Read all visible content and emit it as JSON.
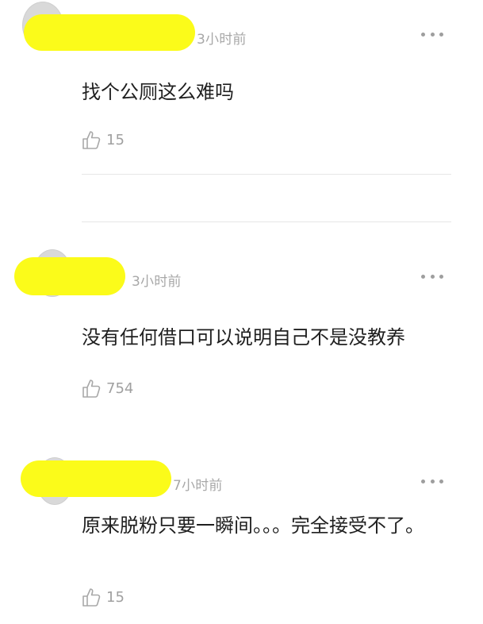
{
  "comments": [
    {
      "time": "3小时前",
      "text": "找个公厕这么难吗",
      "likes": "15",
      "more_icon": "more-dots-icon",
      "like_icon": "thumbs-up-icon"
    },
    {
      "time": "3小时前",
      "text": "没有任何借口可以说明自己不是没教养",
      "likes": "754",
      "more_icon": "more-dots-icon",
      "like_icon": "thumbs-up-icon"
    },
    {
      "time": "7小时前",
      "text": "原来脱粉只要一瞬间。。。完全接受不了。",
      "likes": "15",
      "more_icon": "more-dots-icon",
      "like_icon": "thumbs-up-icon"
    }
  ],
  "colors": {
    "redaction": "#fbfb1a",
    "meta_text": "#a8a8a8",
    "divider": "#e6e6e6"
  }
}
